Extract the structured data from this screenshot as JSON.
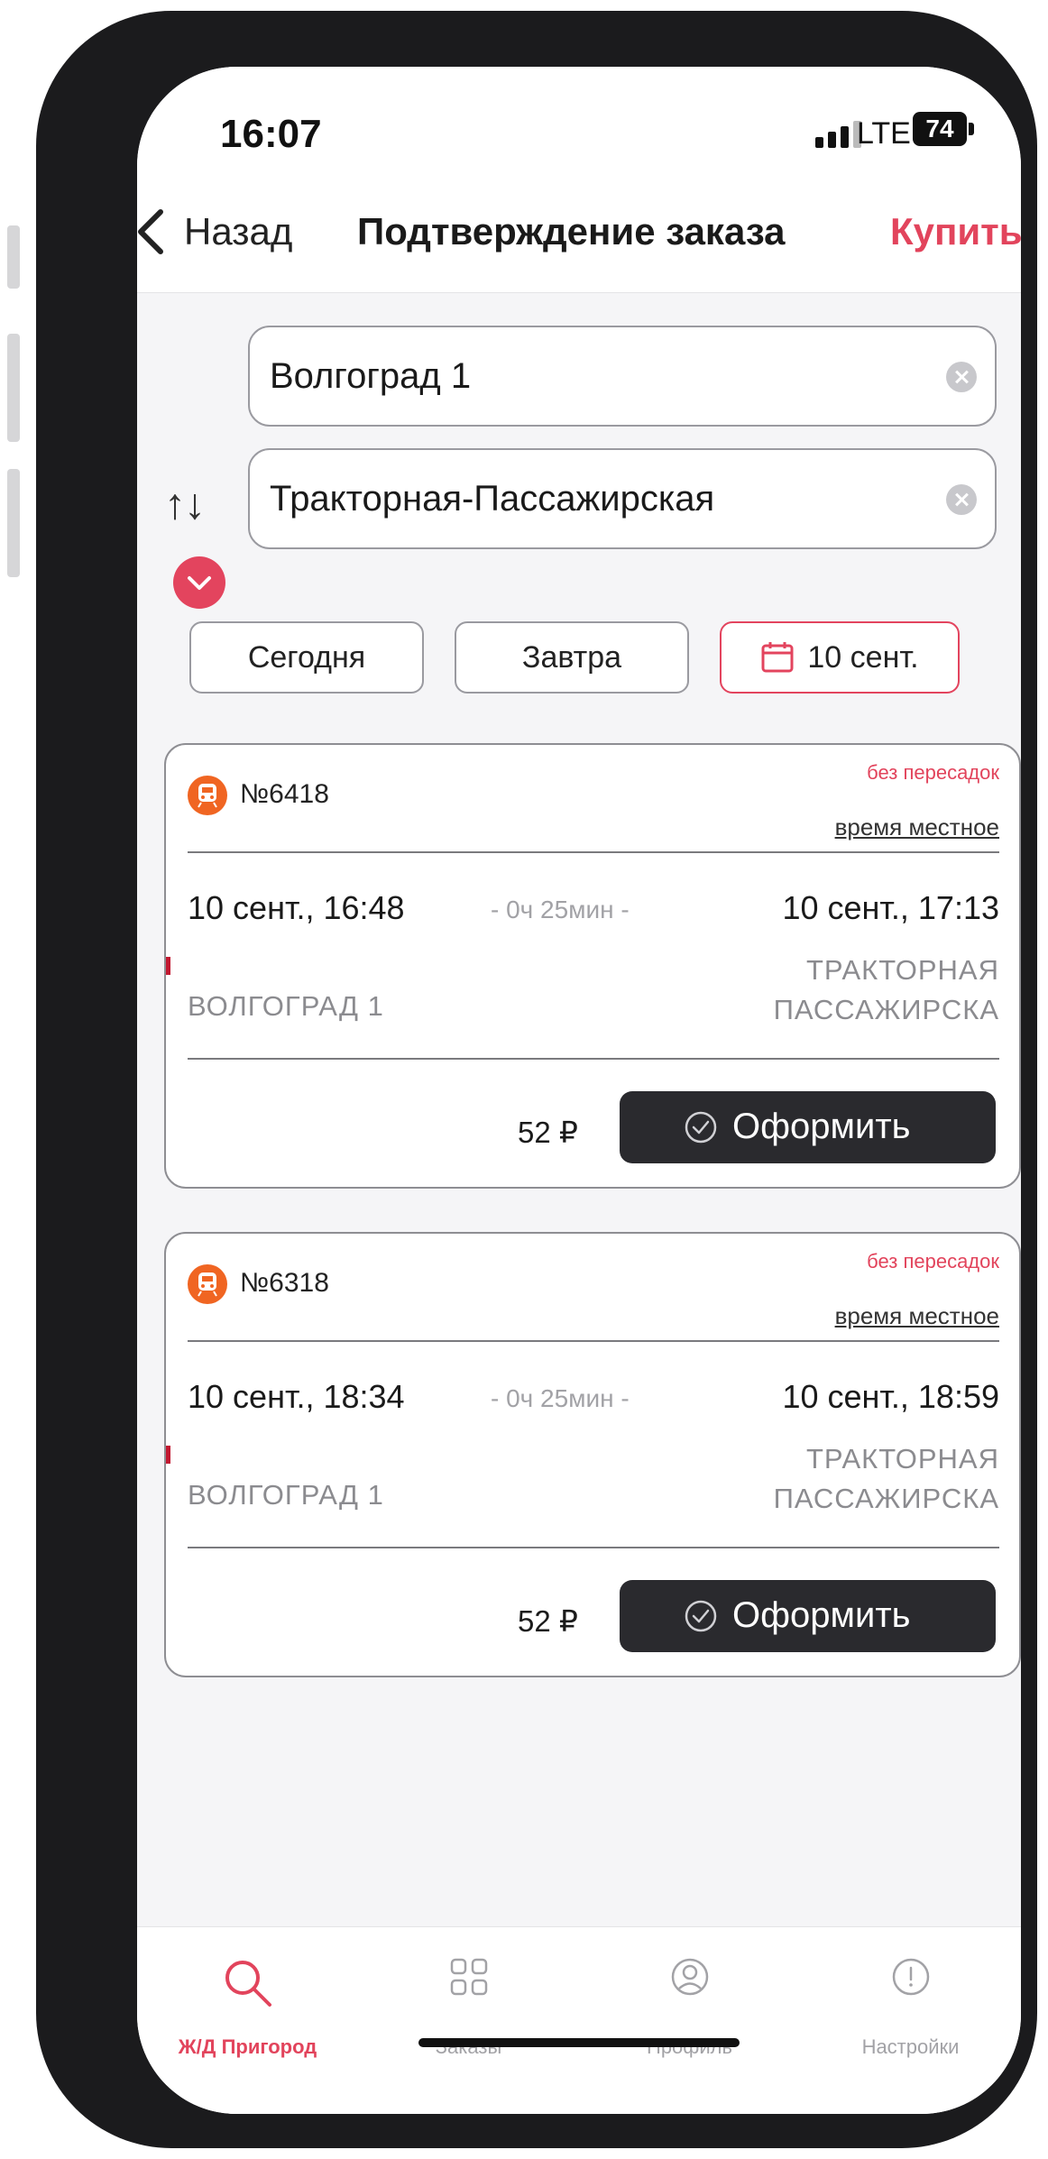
{
  "status_bar": {
    "time": "16:07",
    "network": "LTE",
    "battery": "74"
  },
  "nav": {
    "back_label": "Назад",
    "title": "Подтверждение заказа",
    "action_label": "Купить"
  },
  "search": {
    "from": "Волгоград 1",
    "to": "Тракторная-Пассажирская",
    "swap_icon": "↑↓",
    "dates": {
      "today": "Сегодня",
      "tomorrow": "Завтра",
      "selected": "10 сент."
    }
  },
  "trains": [
    {
      "number": "№6418",
      "transfer_note": "без пересадок",
      "time_note": "время местное",
      "departure": "10 сент., 16:48",
      "duration": "- 0ч 25мин -",
      "arrival": "10 сент., 17:13",
      "from_station": "ВОЛГОГРАД 1",
      "to_station_line1": "ТРАКТОРНАЯ",
      "to_station_line2": "ПАССАЖИРСКА",
      "price": "52 ₽",
      "button_label": "Оформить"
    },
    {
      "number": "№6318",
      "transfer_note": "без пересадок",
      "time_note": "время местное",
      "departure": "10 сент., 18:34",
      "duration": "- 0ч 25мин -",
      "arrival": "10 сент., 18:59",
      "from_station": "ВОЛГОГРАД 1",
      "to_station_line1": "ТРАКТОРНАЯ",
      "to_station_line2": "ПАССАЖИРСКА",
      "price": "52 ₽",
      "button_label": "Оформить"
    }
  ],
  "tabs": [
    {
      "label": "Ж/Д Пригород",
      "icon": "search-icon",
      "active": true
    },
    {
      "label": "Заказы",
      "icon": "grid-icon",
      "active": false
    },
    {
      "label": "Профиль",
      "icon": "profile-icon",
      "active": false
    },
    {
      "label": "Настройки",
      "icon": "info-icon",
      "active": false
    }
  ],
  "colors": {
    "accent": "#e2445c",
    "train_icon": "#f06522",
    "button_dark": "#2a2a2e"
  }
}
